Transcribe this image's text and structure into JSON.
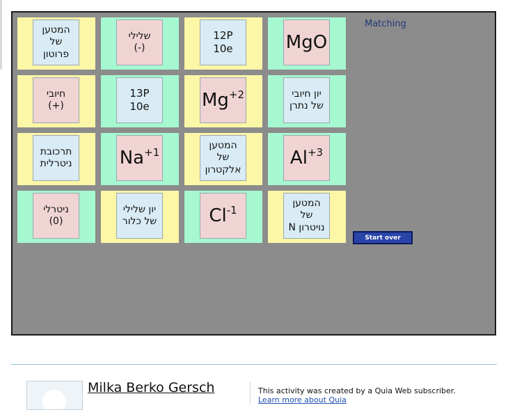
{
  "game": {
    "title": "Matching",
    "start_over": "Start over",
    "colors": {
      "yellow": "#fcf7a6",
      "green": "#a5f8d0",
      "pink": "#f0d4d4",
      "blue": "#d9ecf5"
    },
    "rows": [
      [
        {
          "id": "r0c0",
          "tile": "yellow",
          "card": "blue",
          "kind": "hebrew",
          "lines": [
            "המטען",
            "של",
            "פרוטון"
          ]
        },
        {
          "id": "r0c1",
          "tile": "green",
          "card": "pink",
          "kind": "hebrew",
          "lines": [
            "שלילי",
            "(-)"
          ]
        },
        {
          "id": "r0c2",
          "tile": "yellow",
          "card": "blue",
          "kind": "nums",
          "lines": [
            "12P",
            "10e"
          ]
        },
        {
          "id": "r0c3",
          "tile": "green",
          "card": "pink",
          "kind": "formula",
          "base": "MgO",
          "sup": ""
        }
      ],
      [
        {
          "id": "r1c0",
          "tile": "yellow",
          "card": "pink",
          "kind": "hebrew",
          "lines": [
            "חיובי",
            "(+)"
          ]
        },
        {
          "id": "r1c1",
          "tile": "green",
          "card": "blue",
          "kind": "nums",
          "lines": [
            "13P",
            "10e"
          ]
        },
        {
          "id": "r1c2",
          "tile": "yellow",
          "card": "pink",
          "kind": "formula",
          "base": "Mg",
          "sup": "+2"
        },
        {
          "id": "r1c3",
          "tile": "green",
          "card": "blue",
          "kind": "hebrew",
          "lines": [
            "יון חיובי",
            "של נתרן"
          ]
        }
      ],
      [
        {
          "id": "r2c0",
          "tile": "yellow",
          "card": "blue",
          "kind": "hebrew",
          "lines": [
            "תרכובת",
            "ניטרלית"
          ]
        },
        {
          "id": "r2c1",
          "tile": "green",
          "card": "pink",
          "kind": "formula",
          "base": "Na",
          "sup": "+1"
        },
        {
          "id": "r2c2",
          "tile": "yellow",
          "card": "blue",
          "kind": "hebrew",
          "lines": [
            "המטען",
            "של",
            "אלקטרון"
          ]
        },
        {
          "id": "r2c3",
          "tile": "green",
          "card": "pink",
          "kind": "formula",
          "base": "Al",
          "sup": "+3"
        }
      ],
      [
        {
          "id": "r3c0",
          "tile": "green",
          "card": "pink",
          "kind": "hebrew",
          "lines": [
            "ניטרלי",
            "(0)"
          ]
        },
        {
          "id": "r3c1",
          "tile": "yellow",
          "card": "blue",
          "kind": "hebrew",
          "lines": [
            "יון שלילי",
            "של כלור"
          ]
        },
        {
          "id": "r3c2",
          "tile": "green",
          "card": "pink",
          "kind": "formula",
          "base": "Cl",
          "sup": "-1"
        },
        {
          "id": "r3c3",
          "tile": "yellow",
          "card": "blue",
          "kind": "hebrew",
          "lines": [
            "המטען",
            "של",
            "נויטרון N"
          ]
        }
      ]
    ]
  },
  "footer": {
    "author": "Milka Berko Gersch",
    "credit": "This activity was created by a Quia Web subscriber.",
    "learn_more": "Learn more about Quia"
  }
}
